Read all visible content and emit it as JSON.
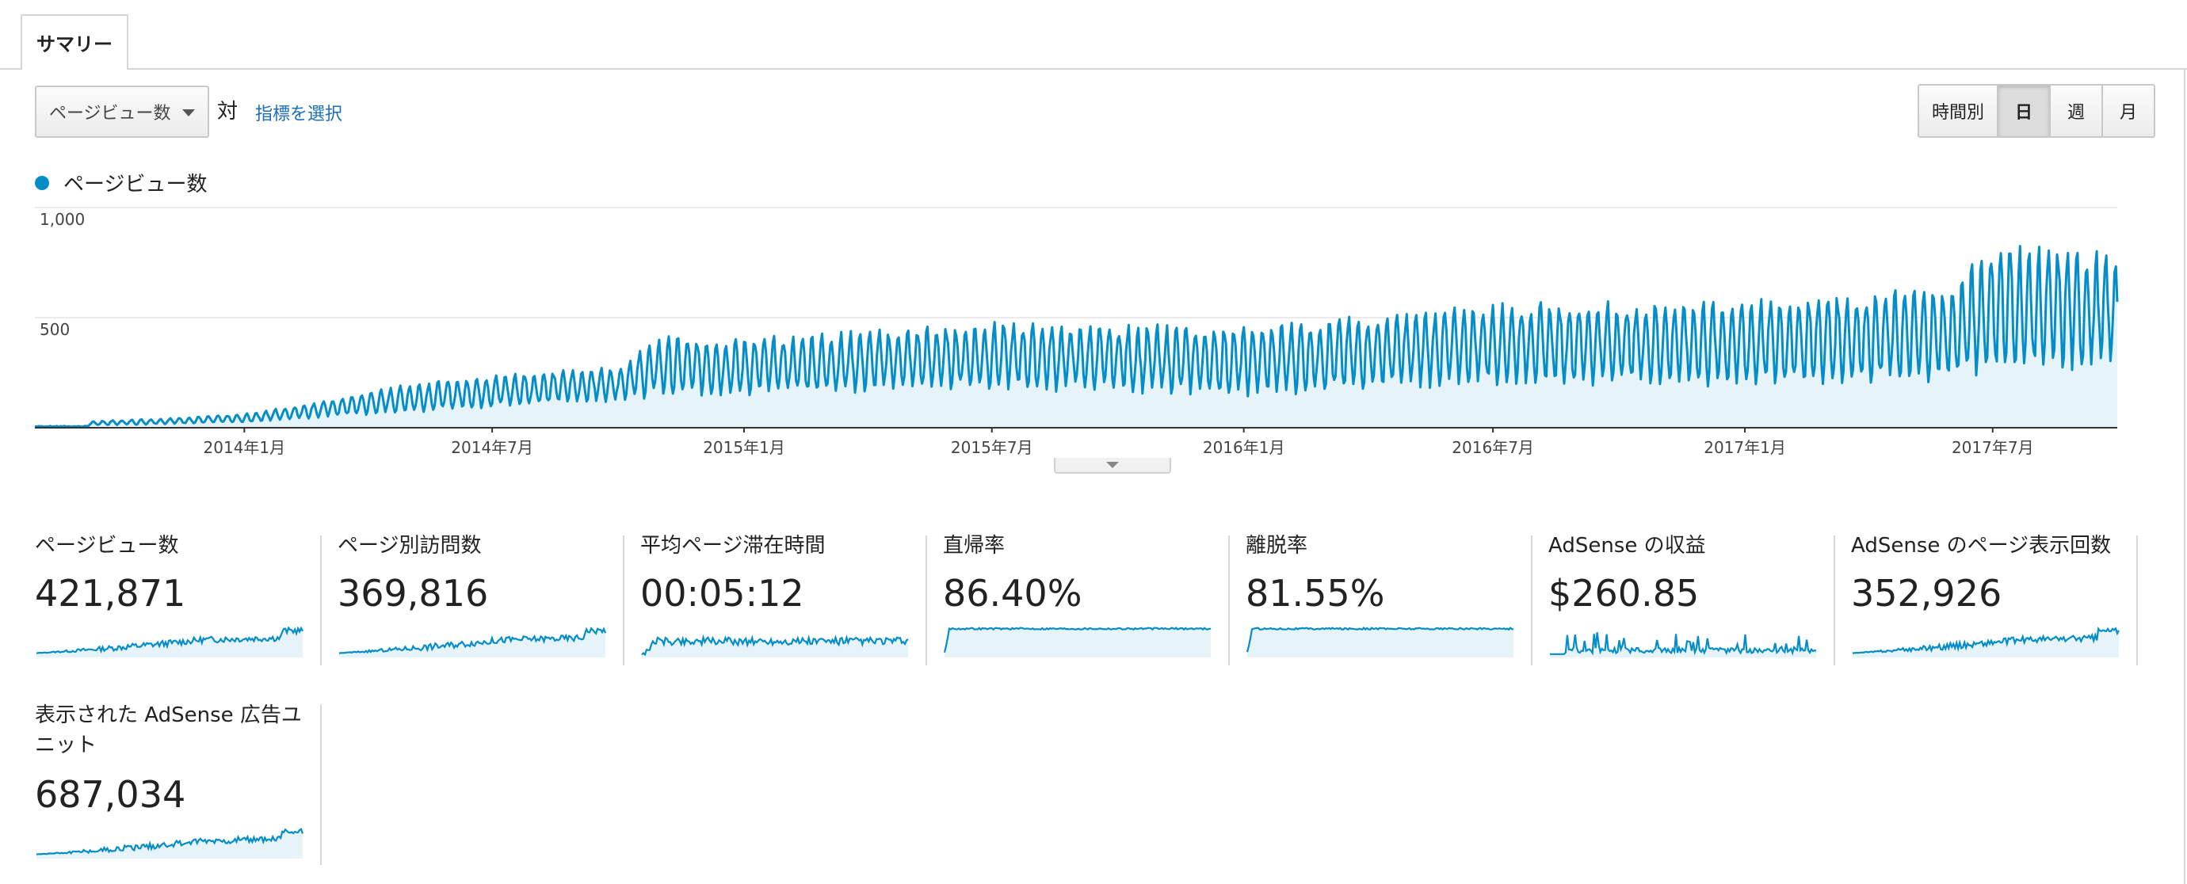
{
  "tabs": {
    "summary": "サマリー"
  },
  "controls": {
    "metric_selected": "ページビュー数",
    "vs_label": "対",
    "pick_metric_link": "指標を選択",
    "periods": [
      "時間別",
      "日",
      "週",
      "月"
    ],
    "active_period": "日"
  },
  "legend": {
    "label": "ページビュー数"
  },
  "colors": {
    "line": "#058dc7",
    "fill": "#e6f3f9",
    "grid": "#ebebeb"
  },
  "icons": {
    "dropdown": "caret-down-icon",
    "collapse": "chevron-down-icon",
    "legend": "series-dot-icon"
  },
  "chart_data": {
    "type": "line",
    "series_name": "ページビュー数",
    "ylim": [
      0,
      1000
    ],
    "y_ticks": [
      {
        "value": 1000,
        "label": "1,000"
      },
      {
        "value": 500,
        "label": "500"
      }
    ],
    "x_range": [
      "2013-08-01",
      "2017-09-30"
    ],
    "x_ticks": [
      {
        "date": "2014-01-01",
        "label": "2014年1月"
      },
      {
        "date": "2014-07-01",
        "label": "2014年7月"
      },
      {
        "date": "2015-01-01",
        "label": "2015年1月"
      },
      {
        "date": "2015-07-01",
        "label": "2015年7月"
      },
      {
        "date": "2016-01-01",
        "label": "2016年1月"
      },
      {
        "date": "2016-07-01",
        "label": "2016年7月"
      },
      {
        "date": "2017-01-01",
        "label": "2017年1月"
      },
      {
        "date": "2017-07-01",
        "label": "2017年7月"
      }
    ],
    "weekly_high_trend": [
      {
        "date": "2013-08-01",
        "value": 20
      },
      {
        "date": "2013-11-01",
        "value": 40
      },
      {
        "date": "2014-01-01",
        "value": 60
      },
      {
        "date": "2014-03-01",
        "value": 120
      },
      {
        "date": "2014-05-01",
        "value": 190
      },
      {
        "date": "2014-07-01",
        "value": 230
      },
      {
        "date": "2014-10-01",
        "value": 270
      },
      {
        "date": "2014-11-01",
        "value": 400
      },
      {
        "date": "2015-01-01",
        "value": 390
      },
      {
        "date": "2015-07-01",
        "value": 460
      },
      {
        "date": "2016-01-01",
        "value": 440
      },
      {
        "date": "2016-07-01",
        "value": 540
      },
      {
        "date": "2017-01-01",
        "value": 560
      },
      {
        "date": "2017-06-01",
        "value": 610
      },
      {
        "date": "2017-07-01",
        "value": 810
      },
      {
        "date": "2017-09-30",
        "value": 760
      }
    ],
    "weekly_low_trend": [
      {
        "date": "2013-08-01",
        "value": 5
      },
      {
        "date": "2014-01-01",
        "value": 20
      },
      {
        "date": "2014-07-01",
        "value": 80
      },
      {
        "date": "2014-11-01",
        "value": 120
      },
      {
        "date": "2015-07-01",
        "value": 150
      },
      {
        "date": "2016-01-01",
        "value": 120
      },
      {
        "date": "2016-07-01",
        "value": 170
      },
      {
        "date": "2017-01-01",
        "value": 150
      },
      {
        "date": "2017-07-01",
        "value": 190
      },
      {
        "date": "2017-09-30",
        "value": 220
      }
    ]
  },
  "metrics": [
    {
      "title": "ページビュー数",
      "value": "421,871",
      "spark": "growth"
    },
    {
      "title": "ページ別訪問数",
      "value": "369,816",
      "spark": "growth"
    },
    {
      "title": "平均ページ滞在時間",
      "value": "00:05:12",
      "spark": "flat-noisy"
    },
    {
      "title": "直帰率",
      "value": "86.40%",
      "spark": "high-flat"
    },
    {
      "title": "離脱率",
      "value": "81.55%",
      "spark": "high-flat"
    },
    {
      "title": "AdSense の収益",
      "value": "$260.85",
      "spark": "bars"
    },
    {
      "title": "AdSense のページ表示回数",
      "value": "352,926",
      "spark": "growth"
    },
    {
      "title": "表示された AdSense 広告ユニット",
      "value": "687,034",
      "spark": "growth"
    }
  ]
}
